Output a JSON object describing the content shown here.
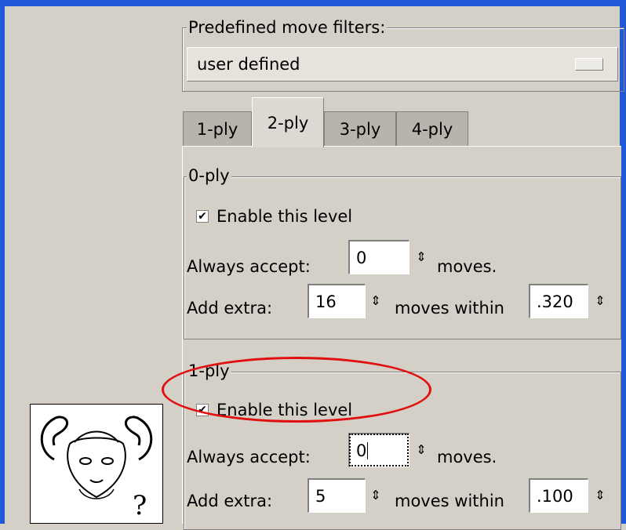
{
  "predefined": {
    "label": "Predefined move filters:",
    "selected": "user defined"
  },
  "tabs": [
    {
      "label": "1-ply"
    },
    {
      "label": "2-ply"
    },
    {
      "label": "3-ply"
    },
    {
      "label": "4-ply"
    }
  ],
  "active_tab": "2-ply",
  "level0": {
    "title": "0-ply",
    "enable_label": "Enable this level",
    "enabled": true,
    "accept_label": "Always accept:",
    "accept_value": "0",
    "moves_label": "moves.",
    "extra_label": "Add extra:",
    "extra_value": "16",
    "within_label": "moves within",
    "within_value": ".320"
  },
  "level1": {
    "title": "1-ply",
    "enable_label": "Enable this level",
    "enabled": true,
    "accept_label": "Always accept:",
    "accept_value": "0",
    "moves_label": "moves.",
    "extra_label": "Add extra:",
    "extra_value": "5",
    "within_label": "moves within",
    "within_value": ".100"
  },
  "icons": {
    "check": "✔",
    "spin": "⇕",
    "logo": "gnu-logo-icon"
  },
  "colors": {
    "window_frame": "#2058d8",
    "highlight_ellipse": "#e01010",
    "dialog_bg": "#d4d0c8"
  }
}
